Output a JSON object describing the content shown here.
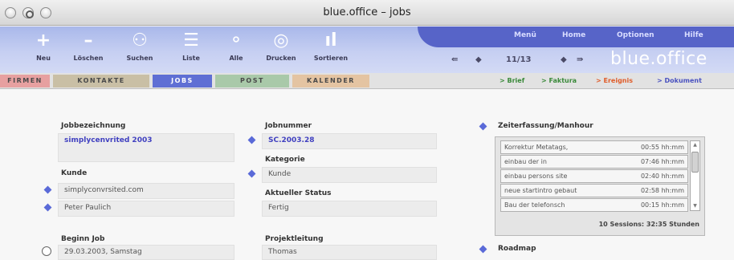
{
  "window": {
    "title": "blue.office – jobs"
  },
  "toolbar": {
    "tools": [
      {
        "label": "Neu",
        "icon": "plus-icon",
        "glyph": "+"
      },
      {
        "label": "Löschen",
        "icon": "minus-icon",
        "glyph": "–"
      },
      {
        "label": "Suchen",
        "icon": "binoculars-icon",
        "glyph": "⚇"
      },
      {
        "label": "Liste",
        "icon": "list-icon",
        "glyph": "☰"
      },
      {
        "label": "Alle",
        "icon": "all-records-icon",
        "glyph": "⚬"
      },
      {
        "label": "Drucken",
        "icon": "print-icon",
        "glyph": "◎"
      },
      {
        "label": "Sortieren",
        "icon": "sort-icon",
        "glyph": "ıl"
      }
    ],
    "nav_links": [
      "Menü",
      "Home",
      "Optionen",
      "Hilfe"
    ],
    "pager": {
      "first": "⇚",
      "prev": "◆",
      "position": "11/13",
      "next": "◆",
      "last": "⇛"
    },
    "brand": "blue.office"
  },
  "tabs": [
    "FIRMEN",
    "KONTAKTE",
    "JOBS",
    "POST",
    "KALENDER"
  ],
  "quick_links": [
    "> Brief",
    "> Faktura",
    "> Ereignis",
    "> Dokument"
  ],
  "form": {
    "job_label": "Jobbezeichnung",
    "job_value": "simplycenvrited 2003",
    "customer_label": "Kunde",
    "customer_lines": [
      "simplyconvrsited.com",
      "Peter Paulich"
    ],
    "begin_label": "Beginn Job",
    "begin_value": "29.03.2003, Samstag",
    "jobnumber_label": "Jobnummer",
    "jobnumber_value": "SC.2003.28",
    "category_label": "Kategorie",
    "category_value": "Kunde",
    "status_label": "Aktueller Status",
    "status_value": "Fertig",
    "projectlead_label": "Projektleitung",
    "projectlead_value": "Thomas"
  },
  "time_tracking": {
    "title": "Zeiterfassung/Manhour",
    "rows": [
      {
        "desc": "Korrektur Metatags,",
        "time": "00:55 hh:mm"
      },
      {
        "desc": "einbau der in",
        "time": "07:46 hh:mm"
      },
      {
        "desc": "einbau persons site",
        "time": "02:40 hh:mm"
      },
      {
        "desc": "neue startintro gebaut",
        "time": "02:58 hh:mm"
      },
      {
        "desc": "Bau der telefonsch",
        "time": "00:15 hh:mm"
      }
    ],
    "summary": "10 Sessions: 32:35 Stunden",
    "roadmap_label": "Roadmap"
  },
  "colors": {
    "accent": "#5764c8",
    "tab_firmen": "#e7a0a0",
    "tab_kontakte": "#c9bfa5",
    "tab_jobs": "#5f6fd4",
    "tab_post": "#a9c9a9",
    "tab_kalender": "#e4c4a2"
  }
}
